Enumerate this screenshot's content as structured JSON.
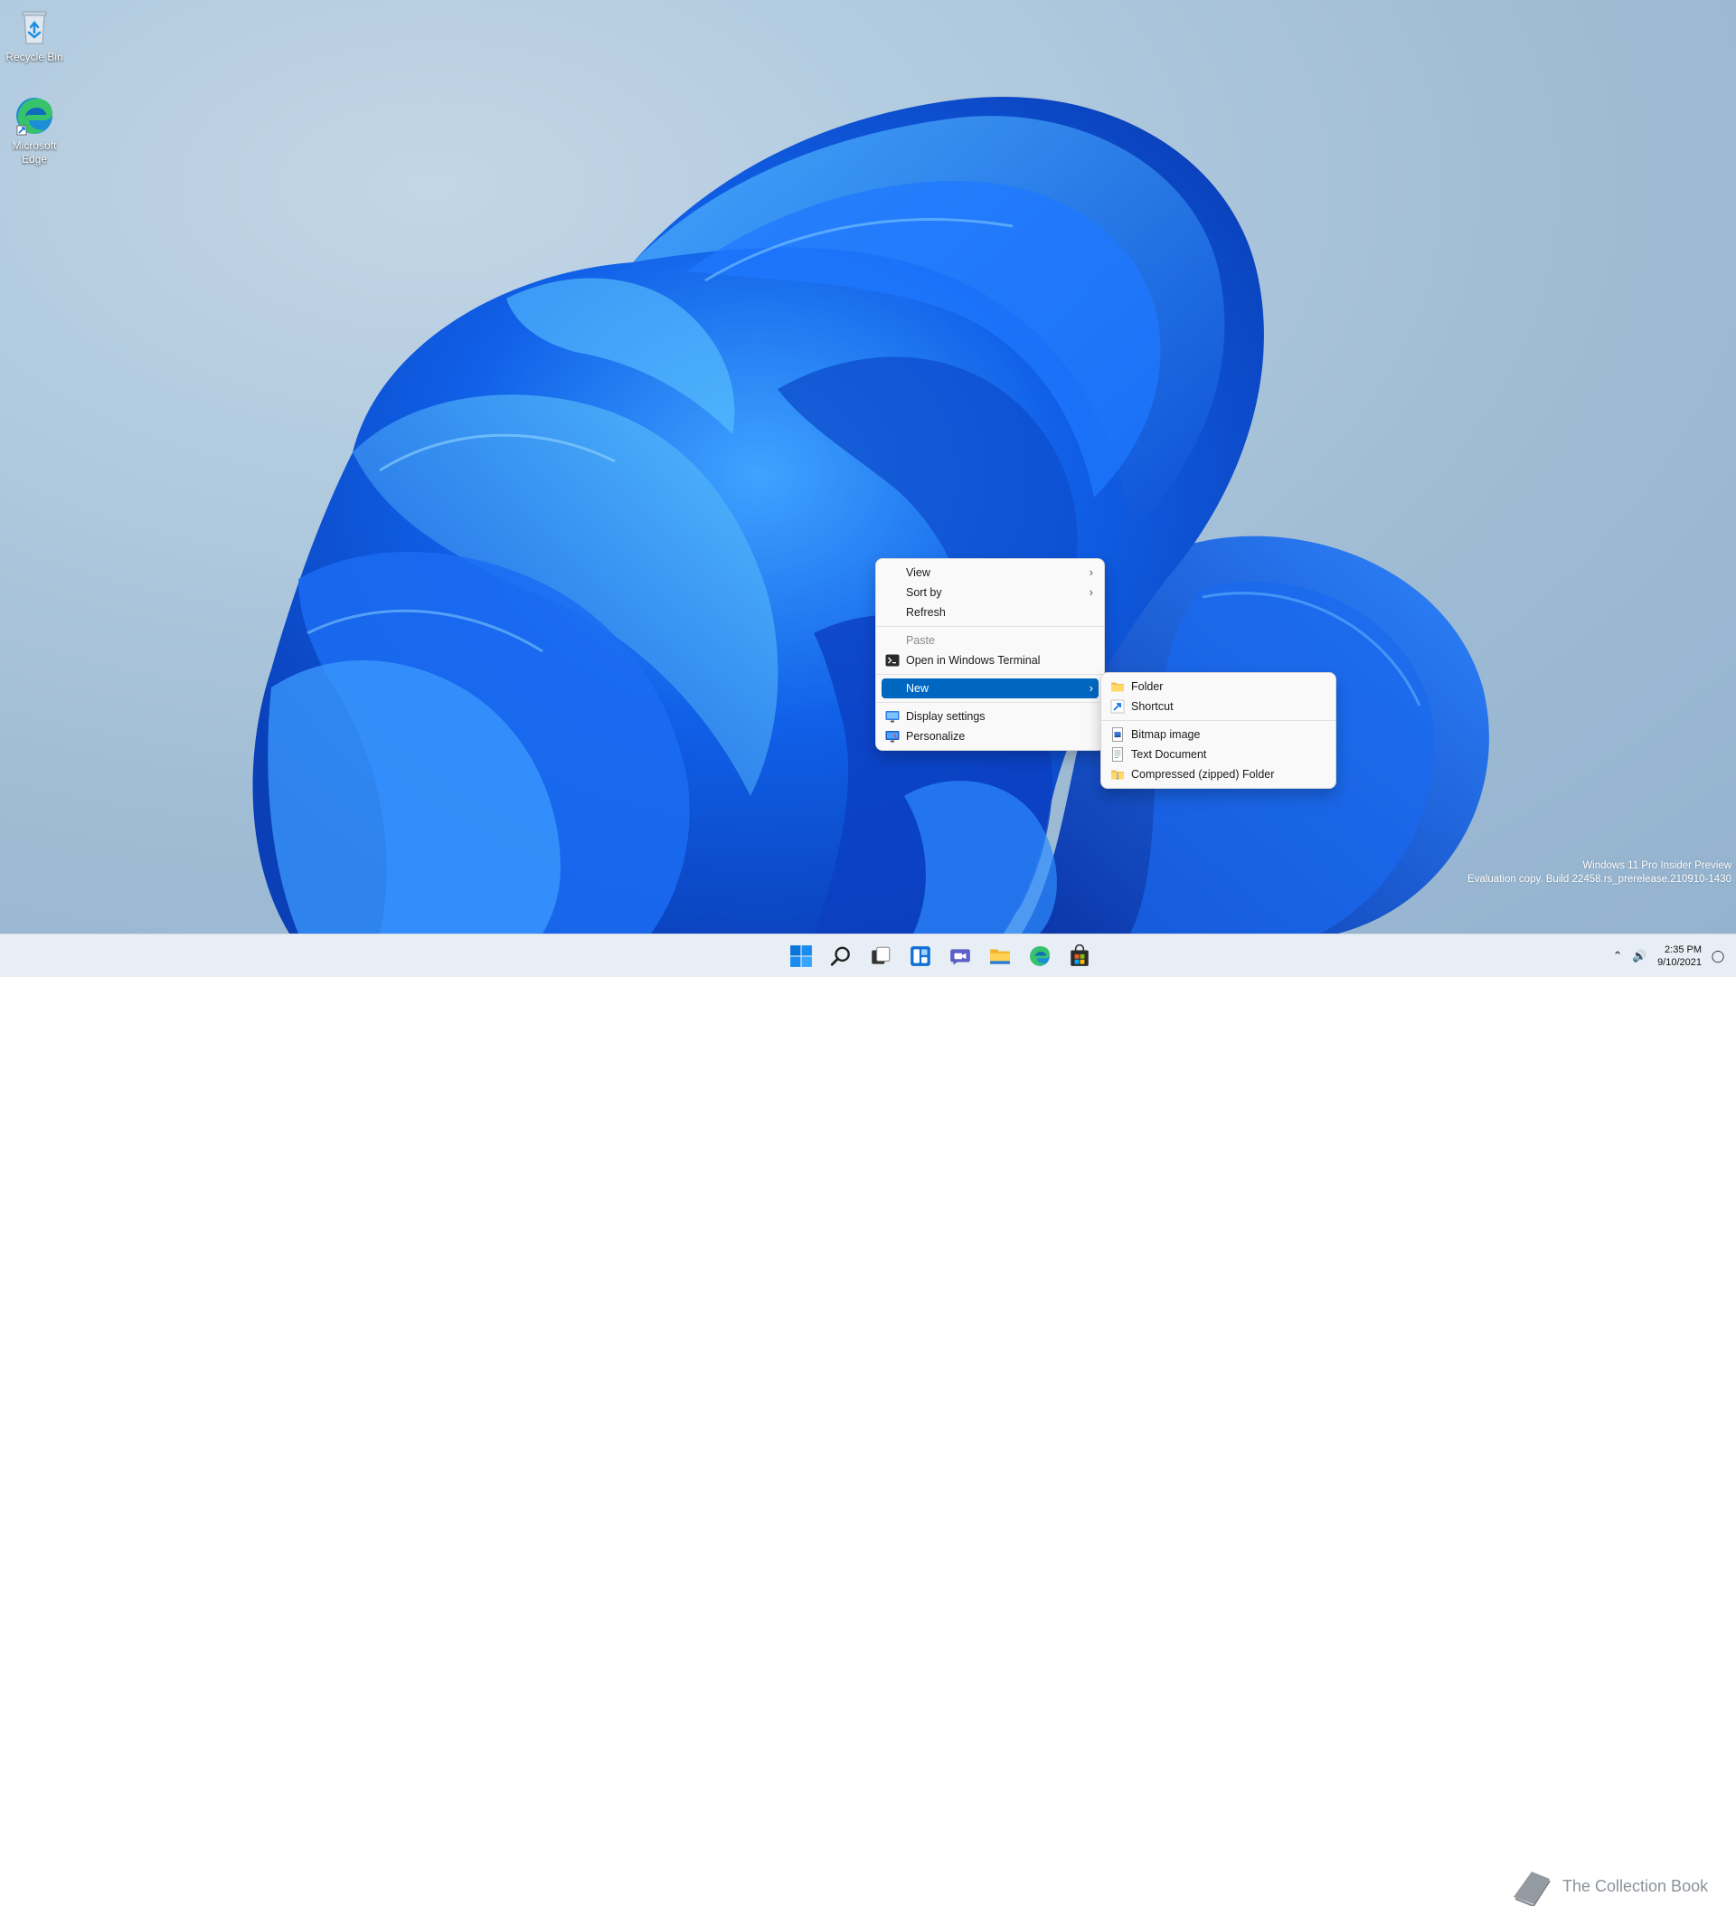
{
  "desktop": {
    "icons": [
      {
        "label": "Recycle Bin",
        "icon": "recycle-bin-icon"
      },
      {
        "label": "Microsoft Edge",
        "icon": "edge-icon"
      }
    ]
  },
  "context_menu": {
    "items": [
      {
        "label": "View",
        "has_submenu": true
      },
      {
        "label": "Sort by",
        "has_submenu": true
      },
      {
        "label": "Refresh"
      },
      {
        "label": "Paste",
        "disabled": true
      },
      {
        "label": "Open in Windows Terminal",
        "icon": "terminal-icon"
      },
      {
        "label": "New",
        "has_submenu": true,
        "highlighted": true
      },
      {
        "label": "Display settings",
        "icon": "display-icon"
      },
      {
        "label": "Personalize",
        "icon": "personalize-icon"
      }
    ]
  },
  "submenu_new": {
    "items": [
      {
        "label": "Folder",
        "icon": "folder-icon"
      },
      {
        "label": "Shortcut",
        "icon": "shortcut-icon"
      },
      {
        "label": "Bitmap image",
        "icon": "bitmap-icon"
      },
      {
        "label": "Text Document",
        "icon": "text-document-icon"
      },
      {
        "label": "Compressed (zipped) Folder",
        "icon": "zip-folder-icon"
      }
    ]
  },
  "watermark": {
    "line1": "Windows 11 Pro Insider Preview",
    "line2": "Evaluation copy. Build 22458.rs_prerelease.210910-1430"
  },
  "taskbar": {
    "apps": [
      "start-icon",
      "search-icon",
      "task-view-icon",
      "widgets-icon",
      "chat-icon",
      "file-explorer-icon",
      "edge-icon",
      "store-icon"
    ]
  },
  "tray": {
    "time": "2:35 PM",
    "date": "9/10/2021"
  },
  "brand": {
    "text": "The Collection Book"
  },
  "colors": {
    "accent": "#0067c0",
    "taskbar": "#e8eef5",
    "menu_bg": "#f9f9f9"
  }
}
